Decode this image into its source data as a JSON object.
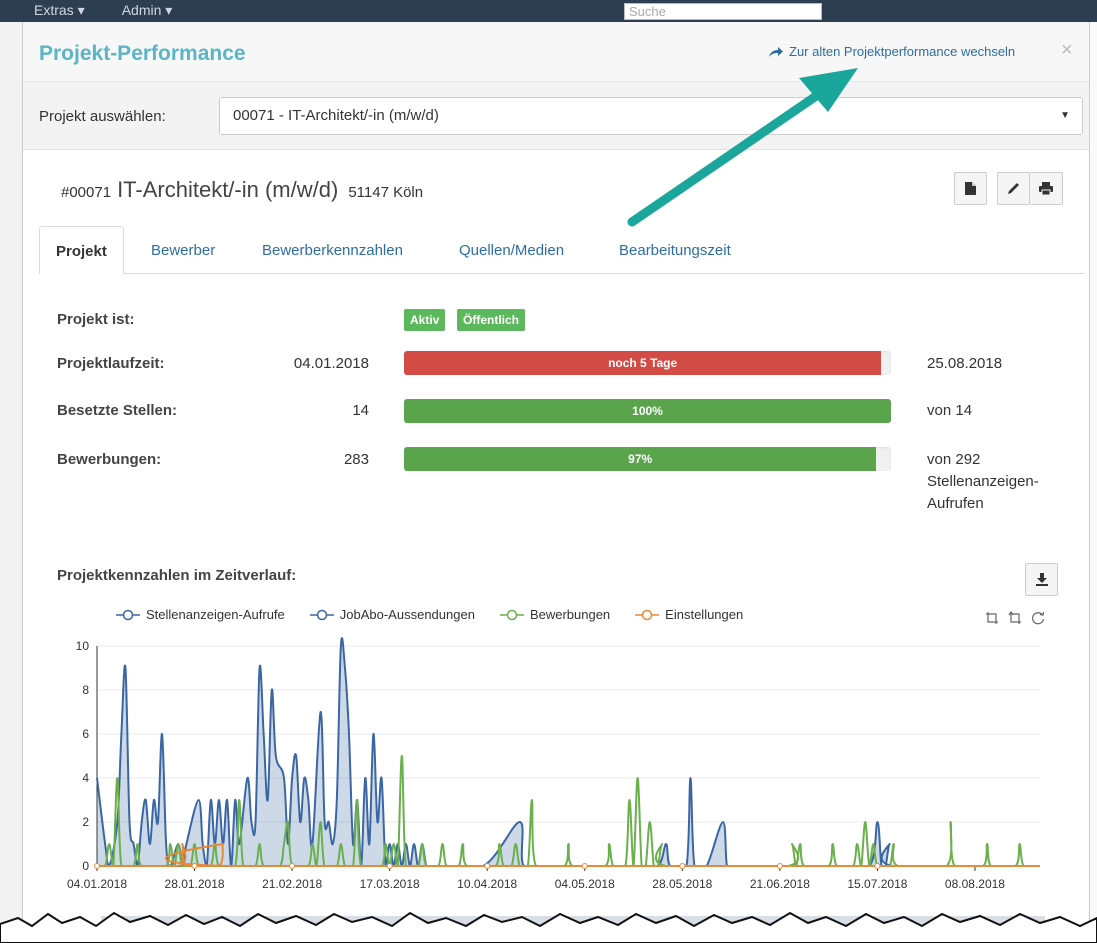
{
  "background": {
    "menu": [
      "Extras ▾",
      "Admin ▾"
    ],
    "search_placeholder": "Suche"
  },
  "modal": {
    "title": "Projekt-Performance",
    "old_link": "Zur alten Projektperformance wechseln",
    "close": "×"
  },
  "project_select": {
    "label": "Projekt auswählen:",
    "value": "00071 - IT-Architekt/-in (m/w/d)"
  },
  "project": {
    "number": "#00071",
    "name": "IT-Architekt/-in (m/w/d)",
    "location": "51147 Köln"
  },
  "tabs": [
    {
      "label": "Projekt",
      "active": true
    },
    {
      "label": "Bewerber",
      "active": false
    },
    {
      "label": "Bewerberkennzahlen",
      "active": false
    },
    {
      "label": "Quellen/Medien",
      "active": false
    },
    {
      "label": "Bearbeitungszeit",
      "active": false
    }
  ],
  "status": {
    "label": "Projekt ist:",
    "badges": [
      "Aktiv",
      "Öffentlich"
    ]
  },
  "rows": {
    "laufzeit": {
      "label": "Projektlaufzeit:",
      "start": "04.01.2018",
      "bar_text": "noch 5 Tage",
      "fill": 0.98,
      "end": "25.08.2018",
      "color": "#d24b45"
    },
    "stellen": {
      "label": "Besetzte Stellen:",
      "value": "14",
      "bar_text": "100%",
      "fill": 1.0,
      "end": "von 14",
      "color": "#5aa54c"
    },
    "bewerbungen": {
      "label": "Bewerbungen:",
      "value": "283",
      "bar_text": "97%",
      "fill": 0.97,
      "end": "von 292 Stellenanzeigen-Aufrufen",
      "color": "#5aa54c"
    }
  },
  "chart_title": "Projektkennzahlen im Zeitverlauf:",
  "chart_data": {
    "type": "area",
    "title": "Projektkennzahlen im Zeitverlauf:",
    "ylim": [
      0,
      10
    ],
    "yticks": [
      0,
      2,
      4,
      6,
      8,
      10
    ],
    "xticks": [
      "04.01.2018",
      "28.01.2018",
      "21.02.2018",
      "17.03.2018",
      "10.04.2018",
      "04.05.2018",
      "28.05.2018",
      "21.06.2018",
      "15.07.2018",
      "08.08.2018"
    ],
    "x_start": "04.01.2018",
    "days": 232,
    "legend_position": "top",
    "series": [
      {
        "name": "Stellenanzeigen-Aufrufe",
        "color": "#3a67a4",
        "area": true,
        "points": [
          [
            0,
            4
          ],
          [
            2,
            1
          ],
          [
            3,
            0
          ],
          [
            5,
            2
          ],
          [
            6,
            6
          ],
          [
            7,
            9
          ],
          [
            8,
            2
          ],
          [
            9,
            1
          ],
          [
            10,
            0
          ],
          [
            11,
            2
          ],
          [
            12,
            3
          ],
          [
            13,
            1
          ],
          [
            14,
            3
          ],
          [
            15,
            2
          ],
          [
            16,
            6
          ],
          [
            17,
            1
          ],
          [
            18,
            0
          ],
          [
            20,
            1
          ],
          [
            21,
            0
          ],
          [
            22,
            1
          ],
          [
            25,
            3
          ],
          [
            26,
            1
          ],
          [
            27,
            0
          ],
          [
            28,
            3
          ],
          [
            29,
            1
          ],
          [
            30,
            3
          ],
          [
            31,
            1
          ],
          [
            32,
            3
          ],
          [
            33,
            0
          ],
          [
            34,
            3
          ],
          [
            35,
            1
          ],
          [
            37,
            4
          ],
          [
            38,
            2
          ],
          [
            39,
            2
          ],
          [
            40,
            9
          ],
          [
            41,
            6
          ],
          [
            42,
            3
          ],
          [
            43,
            8
          ],
          [
            44,
            5
          ],
          [
            46,
            4
          ],
          [
            47,
            1
          ],
          [
            48,
            4
          ],
          [
            49,
            5
          ],
          [
            50,
            2
          ],
          [
            51,
            4
          ],
          [
            52,
            3
          ],
          [
            53,
            1
          ],
          [
            55,
            7
          ],
          [
            56,
            2
          ],
          [
            57,
            2
          ],
          [
            58,
            1
          ],
          [
            59,
            3
          ],
          [
            60,
            10
          ],
          [
            61,
            9
          ],
          [
            62,
            6
          ],
          [
            63,
            1
          ],
          [
            64,
            3
          ],
          [
            65,
            0
          ],
          [
            66,
            4
          ],
          [
            67,
            1
          ],
          [
            68,
            6
          ],
          [
            69,
            2
          ],
          [
            70,
            4
          ],
          [
            71,
            0
          ],
          [
            72,
            1
          ],
          [
            73,
            0
          ],
          [
            74,
            1
          ],
          [
            75,
            0
          ],
          [
            76,
            1
          ],
          [
            77,
            0
          ],
          [
            78,
            1
          ],
          [
            79,
            0
          ],
          [
            80,
            1
          ],
          [
            81,
            0
          ],
          [
            82,
            0
          ],
          [
            95,
            0
          ],
          [
            104,
            2
          ],
          [
            105,
            0
          ],
          [
            112,
            0
          ],
          [
            124,
            0
          ],
          [
            126,
            0
          ],
          [
            132,
            0
          ],
          [
            138,
            0
          ],
          [
            140,
            1
          ],
          [
            141,
            0
          ],
          [
            145,
            0
          ],
          [
            146,
            4
          ],
          [
            147,
            0
          ],
          [
            150,
            0
          ],
          [
            154,
            2
          ],
          [
            155,
            0
          ],
          [
            157,
            0
          ],
          [
            162,
            0
          ],
          [
            168,
            0
          ],
          [
            181,
            0
          ],
          [
            190,
            0
          ],
          [
            192,
            2
          ],
          [
            193,
            0
          ],
          [
            194,
            0
          ],
          [
            195,
            1
          ],
          [
            196,
            0
          ],
          [
            232,
            0
          ]
        ]
      },
      {
        "name": "JobAbo-Aussendungen",
        "color": "#3a67a4",
        "area": false,
        "points": [
          [
            0,
            0
          ],
          [
            232,
            0
          ]
        ]
      },
      {
        "name": "Bewerbungen",
        "color": "#6ab04c",
        "area": false,
        "points": [
          [
            0,
            0
          ],
          [
            2,
            0
          ],
          [
            3,
            1
          ],
          [
            4,
            0
          ],
          [
            5,
            4
          ],
          [
            6,
            0
          ],
          [
            9,
            0
          ],
          [
            10,
            1
          ],
          [
            11,
            0
          ],
          [
            17,
            0
          ],
          [
            18,
            1
          ],
          [
            19,
            0
          ],
          [
            20,
            1
          ],
          [
            21,
            0
          ],
          [
            23,
            0
          ],
          [
            24,
            1
          ],
          [
            25,
            0
          ],
          [
            28,
            0
          ],
          [
            29,
            1
          ],
          [
            30,
            0
          ],
          [
            34,
            0
          ],
          [
            35,
            3
          ],
          [
            36,
            0
          ],
          [
            39,
            0
          ],
          [
            40,
            1
          ],
          [
            41,
            0
          ],
          [
            45,
            0
          ],
          [
            46,
            1
          ],
          [
            47,
            2
          ],
          [
            48,
            0
          ],
          [
            52,
            0
          ],
          [
            53,
            1
          ],
          [
            54,
            0
          ],
          [
            55,
            2
          ],
          [
            56,
            0
          ],
          [
            59,
            0
          ],
          [
            60,
            1
          ],
          [
            61,
            0
          ],
          [
            63,
            0
          ],
          [
            64,
            3
          ],
          [
            65,
            0
          ],
          [
            70,
            0
          ],
          [
            71,
            1
          ],
          [
            72,
            0
          ],
          [
            73,
            1
          ],
          [
            74,
            0
          ],
          [
            75,
            5
          ],
          [
            76,
            0
          ],
          [
            79,
            0
          ],
          [
            80,
            1
          ],
          [
            81,
            0
          ],
          [
            84,
            0
          ],
          [
            85,
            1
          ],
          [
            86,
            0
          ],
          [
            89,
            0
          ],
          [
            90,
            1
          ],
          [
            91,
            0
          ],
          [
            98,
            0
          ],
          [
            99,
            1
          ],
          [
            100,
            0
          ],
          [
            102,
            0
          ],
          [
            103,
            1
          ],
          [
            104,
            0
          ],
          [
            106,
            0
          ],
          [
            107,
            3
          ],
          [
            108,
            0
          ],
          [
            115,
            0
          ],
          [
            116,
            1
          ],
          [
            117,
            0
          ],
          [
            125,
            0
          ],
          [
            126,
            1
          ],
          [
            127,
            0
          ],
          [
            130,
            0
          ],
          [
            131,
            3
          ],
          [
            132,
            0
          ],
          [
            133,
            4
          ],
          [
            134,
            0
          ],
          [
            135,
            0
          ],
          [
            136,
            2
          ],
          [
            137,
            0
          ],
          [
            138,
            0
          ],
          [
            139,
            1
          ],
          [
            140,
            0
          ],
          [
            170,
            0
          ],
          [
            171,
            1
          ],
          [
            172,
            0
          ],
          [
            173,
            1
          ],
          [
            174,
            0
          ],
          [
            180,
            0
          ],
          [
            181,
            1
          ],
          [
            182,
            0
          ],
          [
            186,
            0
          ],
          [
            187,
            1
          ],
          [
            188,
            0
          ],
          [
            189,
            2
          ],
          [
            190,
            0
          ],
          [
            191,
            1
          ],
          [
            192,
            0
          ],
          [
            195,
            0
          ],
          [
            196,
            1
          ],
          [
            197,
            0
          ],
          [
            209,
            0
          ],
          [
            210,
            2
          ],
          [
            211,
            0
          ],
          [
            218,
            0
          ],
          [
            219,
            1
          ],
          [
            220,
            0
          ],
          [
            226,
            0
          ],
          [
            227,
            1
          ],
          [
            228,
            0
          ],
          [
            232,
            0
          ]
        ]
      },
      {
        "name": "Einstellungen",
        "color": "#e8893a",
        "area": false,
        "points": [
          [
            0,
            0
          ],
          [
            20,
            0
          ],
          [
            21,
            1
          ],
          [
            22,
            0
          ],
          [
            30,
            0
          ],
          [
            31,
            1
          ],
          [
            32,
            0
          ],
          [
            232,
            0
          ]
        ]
      }
    ]
  }
}
